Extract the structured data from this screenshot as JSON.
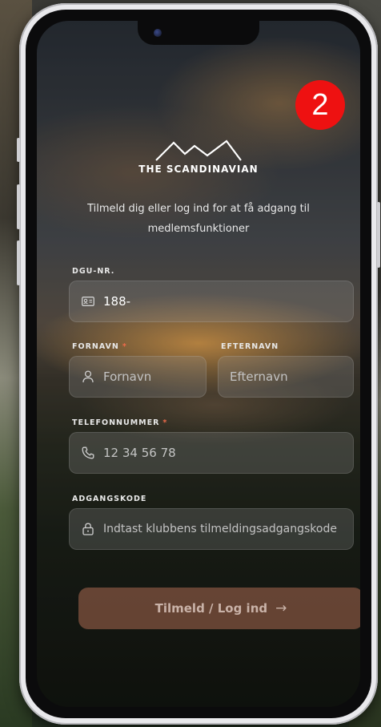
{
  "step_badge": "2",
  "brand": {
    "name": "THE SCANDINAVIAN"
  },
  "intro_text": "Tilmeld dig eller log ind for at få adgang til medlemsfunktioner",
  "form": {
    "dgu": {
      "label": "DGU-NR.",
      "value": "188-",
      "icon": "id-card-icon"
    },
    "fornavn": {
      "label": "FORNAVN",
      "required_mark": "*",
      "placeholder": "Fornavn",
      "icon": "user-icon"
    },
    "efternavn": {
      "label": "EFTERNAVN",
      "placeholder": "Efternavn"
    },
    "telefon": {
      "label": "TELEFONNUMMER",
      "required_mark": "*",
      "placeholder": "12 34 56 78",
      "icon": "phone-icon"
    },
    "adgangskode": {
      "label": "ADGANGSKODE",
      "placeholder": "Indtast klubbens tilmeldingsadgangskode",
      "icon": "lock-icon"
    }
  },
  "submit": {
    "label": "Tilmeld / Log ind",
    "icon": "arrow-right-icon",
    "arrow": "→"
  },
  "colors": {
    "badge": "#ee1111",
    "required": "#ef6b4a",
    "submit_bg": "#aa6950"
  }
}
